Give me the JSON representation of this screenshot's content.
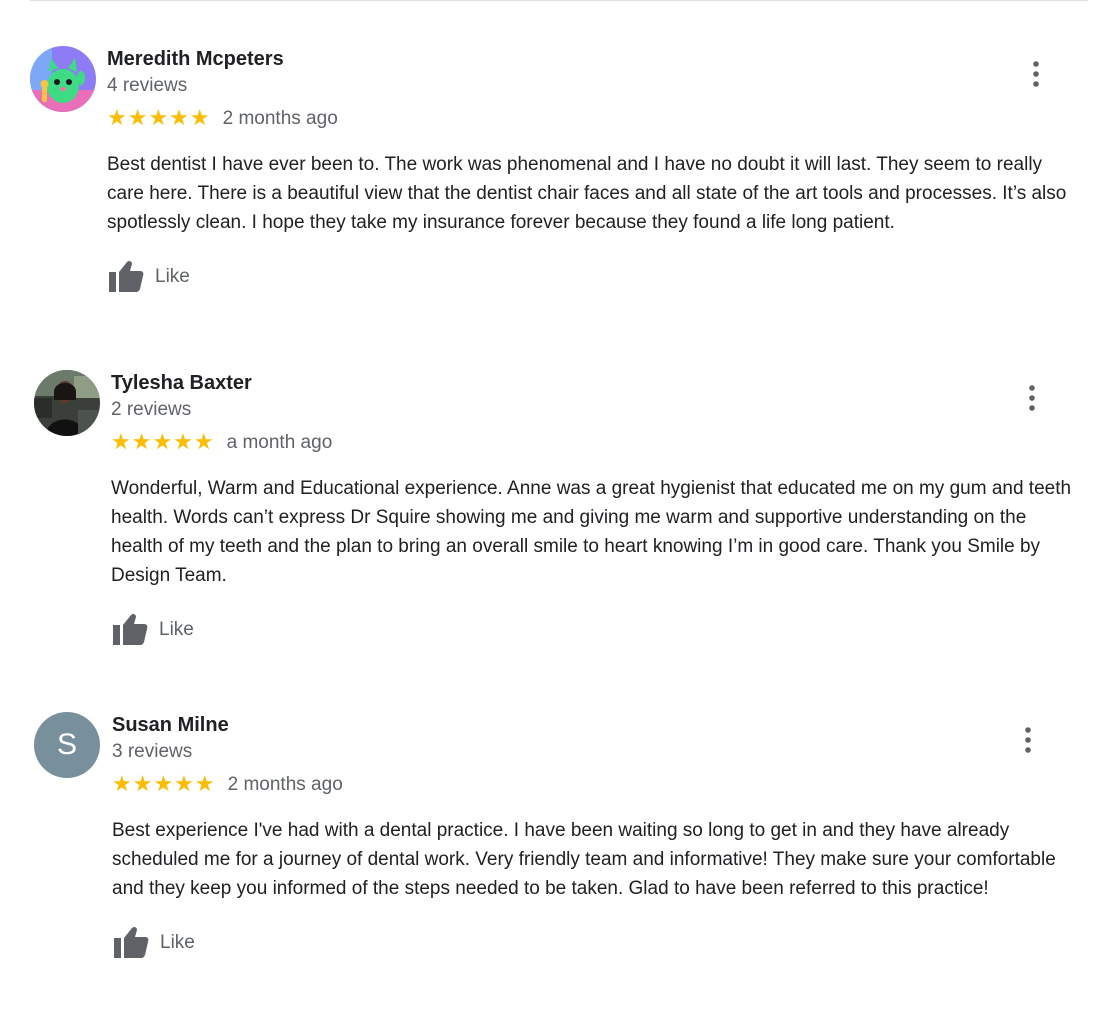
{
  "colors": {
    "star": "#fbbc04",
    "secondary_text": "#5f6368",
    "primary_text": "#202124",
    "avatar_letter_bg": "#78909c"
  },
  "reviews": [
    {
      "author": "Meredith Mcpeters",
      "review_count": "4 reviews",
      "stars": "★★★★★",
      "rating": 5,
      "date": "2 months ago",
      "text": "Best dentist I have ever been to. The work was phenomenal and I have no doubt it will last. They seem to really care here. There is a beautiful view that the dentist chair faces and all state of the art tools and processes. It’s also spotlessly clean. I hope they take my insurance forever because they found a life long patient.",
      "like_label": "Like",
      "avatar_icon": "cartoon-cat-avatar",
      "menu_icon": "more-vert-icon",
      "like_icon": "thumb-up-icon"
    },
    {
      "author": "Tylesha Baxter",
      "review_count": "2 reviews",
      "stars": "★★★★★",
      "rating": 5,
      "date": "a month ago",
      "text": "Wonderful, Warm and Educational experience. Anne was a great hygienist that educated me on my gum and teeth health. Words can’t express Dr Squire showing me and giving me warm and supportive understanding on the health of my teeth and the plan to bring an overall smile to heart knowing I’m in good care. Thank you Smile by Design Team.",
      "like_label": "Like",
      "avatar_icon": "profile-photo-avatar",
      "menu_icon": "more-vert-icon",
      "like_icon": "thumb-up-icon"
    },
    {
      "author": "Susan Milne",
      "review_count": "3 reviews",
      "stars": "★★★★★",
      "rating": 5,
      "date": "2 months ago",
      "text": "Best experience I've had with a dental practice. I have been waiting so long to get in and they have already scheduled me for a journey of dental work. Very friendly team and informative! They make sure your comfortable and they keep you informed of the steps needed to be taken. Glad to have been referred to this practice!",
      "like_label": "Like",
      "avatar_letter": "S",
      "avatar_icon": "letter-avatar",
      "menu_icon": "more-vert-icon",
      "like_icon": "thumb-up-icon"
    }
  ]
}
